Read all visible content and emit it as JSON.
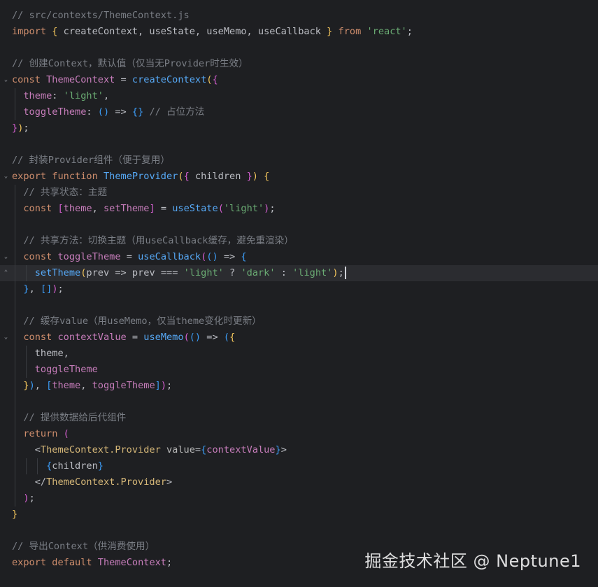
{
  "editor": {
    "file_comment": "// src/contexts/ThemeContext.js",
    "lines": [
      [
        {
          "t": "// src/contexts/ThemeContext.js",
          "c": "cm"
        }
      ],
      [
        {
          "t": "import",
          "c": "kw"
        },
        {
          "t": " "
        },
        {
          "t": "{",
          "c": "b1"
        },
        {
          "t": " createContext, useState, useMemo, useCallback ",
          "c": "id"
        },
        {
          "t": "}",
          "c": "b1"
        },
        {
          "t": " "
        },
        {
          "t": "from",
          "c": "kw"
        },
        {
          "t": " "
        },
        {
          "t": "'react'",
          "c": "str"
        },
        {
          "t": ";"
        }
      ],
      [],
      [
        {
          "t": "// 创建Context，默认值（仅当无Provider时生效）",
          "c": "cm"
        }
      ],
      [
        {
          "t": "const",
          "c": "kw"
        },
        {
          "t": " "
        },
        {
          "t": "ThemeContext",
          "c": "var"
        },
        {
          "t": " = "
        },
        {
          "t": "createContext",
          "c": "fn"
        },
        {
          "t": "(",
          "c": "b1"
        },
        {
          "t": "{",
          "c": "b2"
        }
      ],
      [
        {
          "t": "  theme",
          "c": "prop"
        },
        {
          "t": ": "
        },
        {
          "t": "'light'",
          "c": "str"
        },
        {
          "t": ","
        }
      ],
      [
        {
          "t": "  toggleTheme",
          "c": "prop"
        },
        {
          "t": ": "
        },
        {
          "t": "()",
          "c": "b3"
        },
        {
          "t": " => "
        },
        {
          "t": "{}",
          "c": "b3"
        },
        {
          "t": " "
        },
        {
          "t": "// 占位方法",
          "c": "cm"
        }
      ],
      [
        {
          "t": "}",
          "c": "b2"
        },
        {
          "t": ")",
          "c": "b1"
        },
        {
          "t": ";"
        }
      ],
      [],
      [
        {
          "t": "// 封装Provider组件（便于复用）",
          "c": "cm"
        }
      ],
      [
        {
          "t": "export",
          "c": "kw"
        },
        {
          "t": " "
        },
        {
          "t": "function",
          "c": "kw"
        },
        {
          "t": " "
        },
        {
          "t": "ThemeProvider",
          "c": "fn"
        },
        {
          "t": "(",
          "c": "b1"
        },
        {
          "t": "{",
          "c": "b2"
        },
        {
          "t": " children ",
          "c": "id"
        },
        {
          "t": "}",
          "c": "b2"
        },
        {
          "t": ")",
          "c": "b1"
        },
        {
          "t": " "
        },
        {
          "t": "{",
          "c": "b1"
        }
      ],
      [
        {
          "t": "  // 共享状态：主题",
          "c": "cm"
        }
      ],
      [
        {
          "t": "  const",
          "c": "kw"
        },
        {
          "t": " "
        },
        {
          "t": "[",
          "c": "b2"
        },
        {
          "t": "theme",
          "c": "var"
        },
        {
          "t": ", "
        },
        {
          "t": "setTheme",
          "c": "var"
        },
        {
          "t": "]",
          "c": "b2"
        },
        {
          "t": " = "
        },
        {
          "t": "useState",
          "c": "fn"
        },
        {
          "t": "(",
          "c": "b2"
        },
        {
          "t": "'light'",
          "c": "str"
        },
        {
          "t": ")",
          "c": "b2"
        },
        {
          "t": ";"
        }
      ],
      [],
      [
        {
          "t": "  // 共享方法：切换主题（用useCallback缓存，避免重渲染）",
          "c": "cm"
        }
      ],
      [
        {
          "t": "  const",
          "c": "kw"
        },
        {
          "t": " "
        },
        {
          "t": "toggleTheme",
          "c": "var"
        },
        {
          "t": " = "
        },
        {
          "t": "useCallback",
          "c": "fn"
        },
        {
          "t": "(",
          "c": "b2"
        },
        {
          "t": "()",
          "c": "b3"
        },
        {
          "t": " => "
        },
        {
          "t": "{",
          "c": "b3"
        }
      ],
      [
        {
          "t": "    setTheme",
          "c": "fn"
        },
        {
          "t": "(",
          "c": "b1"
        },
        {
          "t": "prev",
          "c": "id"
        },
        {
          "t": " => "
        },
        {
          "t": "prev",
          "c": "id"
        },
        {
          "t": " === "
        },
        {
          "t": "'light'",
          "c": "str"
        },
        {
          "t": " ? "
        },
        {
          "t": "'dark'",
          "c": "str"
        },
        {
          "t": " : "
        },
        {
          "t": "'light'",
          "c": "str"
        },
        {
          "t": ")",
          "c": "b1"
        },
        {
          "t": ";"
        }
      ],
      [
        {
          "t": "  "
        },
        {
          "t": "}",
          "c": "b3"
        },
        {
          "t": ", "
        },
        {
          "t": "[]",
          "c": "b3"
        },
        {
          "t": ")",
          "c": "b2"
        },
        {
          "t": ";"
        }
      ],
      [],
      [
        {
          "t": "  // 缓存value（用useMemo，仅当theme变化时更新）",
          "c": "cm"
        }
      ],
      [
        {
          "t": "  const",
          "c": "kw"
        },
        {
          "t": " "
        },
        {
          "t": "contextValue",
          "c": "var"
        },
        {
          "t": " = "
        },
        {
          "t": "useMemo",
          "c": "fn"
        },
        {
          "t": "(",
          "c": "b2"
        },
        {
          "t": "()",
          "c": "b3"
        },
        {
          "t": " => "
        },
        {
          "t": "(",
          "c": "b3"
        },
        {
          "t": "{",
          "c": "b1"
        }
      ],
      [
        {
          "t": "    theme",
          "c": "id"
        },
        {
          "t": ","
        }
      ],
      [
        {
          "t": "    toggleTheme",
          "c": "prop"
        }
      ],
      [
        {
          "t": "  "
        },
        {
          "t": "}",
          "c": "b1"
        },
        {
          "t": ")",
          "c": "b3"
        },
        {
          "t": ", "
        },
        {
          "t": "[",
          "c": "b3"
        },
        {
          "t": "theme",
          "c": "var"
        },
        {
          "t": ", "
        },
        {
          "t": "toggleTheme",
          "c": "var"
        },
        {
          "t": "]",
          "c": "b3"
        },
        {
          "t": ")",
          "c": "b2"
        },
        {
          "t": ";"
        }
      ],
      [],
      [
        {
          "t": "  // 提供数据给后代组件",
          "c": "cm"
        }
      ],
      [
        {
          "t": "  return",
          "c": "kw"
        },
        {
          "t": " "
        },
        {
          "t": "(",
          "c": "b2"
        }
      ],
      [
        {
          "t": "    <"
        },
        {
          "t": "ThemeContext.Provider",
          "c": "tag"
        },
        {
          "t": " "
        },
        {
          "t": "value",
          "c": "attr"
        },
        {
          "t": "="
        },
        {
          "t": "{",
          "c": "b3"
        },
        {
          "t": "contextValue",
          "c": "var"
        },
        {
          "t": "}",
          "c": "b3"
        },
        {
          "t": ">"
        }
      ],
      [
        {
          "t": "      "
        },
        {
          "t": "{",
          "c": "b3"
        },
        {
          "t": "children",
          "c": "id"
        },
        {
          "t": "}",
          "c": "b3"
        }
      ],
      [
        {
          "t": "    </"
        },
        {
          "t": "ThemeContext.Provider",
          "c": "tag"
        },
        {
          "t": ">"
        }
      ],
      [
        {
          "t": "  "
        },
        {
          "t": ")",
          "c": "b2"
        },
        {
          "t": ";"
        }
      ],
      [
        {
          "t": "}",
          "c": "b1"
        }
      ],
      [],
      [
        {
          "t": "// 导出Context（供消费使用）",
          "c": "cm"
        }
      ],
      [
        {
          "t": "export",
          "c": "kw"
        },
        {
          "t": " "
        },
        {
          "t": "default",
          "c": "kw"
        },
        {
          "t": " "
        },
        {
          "t": "ThemeContext",
          "c": "var"
        },
        {
          "t": ";"
        }
      ]
    ],
    "fold_lines": [
      4,
      10,
      15,
      20
    ],
    "fold_end_lines": [
      16
    ],
    "active_line": 16,
    "cursor_line": 16
  },
  "watermark": "掘金技术社区 @ Neptune1",
  "colors": {
    "background": "#1e1f22",
    "keyword": "#cf8e6d",
    "function": "#56a8f5",
    "variable": "#c77dbb",
    "string": "#6aab73",
    "comment": "#7a7e85"
  }
}
